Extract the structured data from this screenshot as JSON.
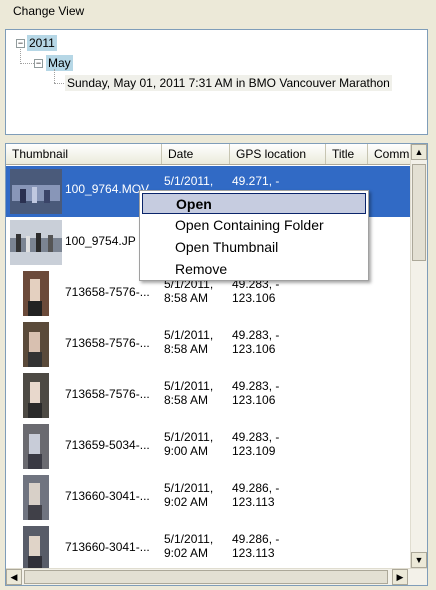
{
  "title": "Change View",
  "tree": {
    "year": "2011",
    "month": "May",
    "event": "Sunday, May 01, 2011 7:31 AM in BMO Vancouver Marathon"
  },
  "columns": [
    "Thumbnail",
    "Date",
    "GPS location",
    "Title",
    "Comm"
  ],
  "rows": [
    {
      "name": "100_9764.MOV",
      "date1": "5/1/2011,",
      "date2": "",
      "gps1": "49.271, -",
      "gps2": ""
    },
    {
      "name": "100_9754.JP",
      "date1": "",
      "date2": "",
      "gps1": "",
      "gps2": ""
    },
    {
      "name": "713658-7576-...",
      "date1": "5/1/2011,",
      "date2": "8:58 AM",
      "gps1": "49.283, -",
      "gps2": "123.106"
    },
    {
      "name": "713658-7576-...",
      "date1": "5/1/2011,",
      "date2": "8:58 AM",
      "gps1": "49.283, -",
      "gps2": "123.106"
    },
    {
      "name": "713658-7576-...",
      "date1": "5/1/2011,",
      "date2": "8:58 AM",
      "gps1": "49.283, -",
      "gps2": "123.106"
    },
    {
      "name": "713659-5034-...",
      "date1": "5/1/2011,",
      "date2": "9:00 AM",
      "gps1": "49.283, -",
      "gps2": "123.109"
    },
    {
      "name": "713660-3041-...",
      "date1": "5/1/2011,",
      "date2": "9:02 AM",
      "gps1": "49.286, -",
      "gps2": "123.113"
    },
    {
      "name": "713660-3041-...",
      "date1": "5/1/2011,",
      "date2": "9:02 AM",
      "gps1": "49.286, -",
      "gps2": "123.113"
    }
  ],
  "context_menu": {
    "items": [
      "Open",
      "Open Containing Folder",
      "Open Thumbnail",
      "Remove"
    ],
    "highlighted": "Open"
  },
  "colors": {
    "selection": "#316ac5",
    "tree_highlight": "#b6d7e6",
    "menu_highlight": "#c6cce0"
  },
  "icons": {
    "expand": "minus-box-icon",
    "scroll_up": "arrow-up-icon",
    "scroll_down": "arrow-down-icon",
    "scroll_left": "arrow-left-icon",
    "scroll_right": "arrow-right-icon"
  }
}
